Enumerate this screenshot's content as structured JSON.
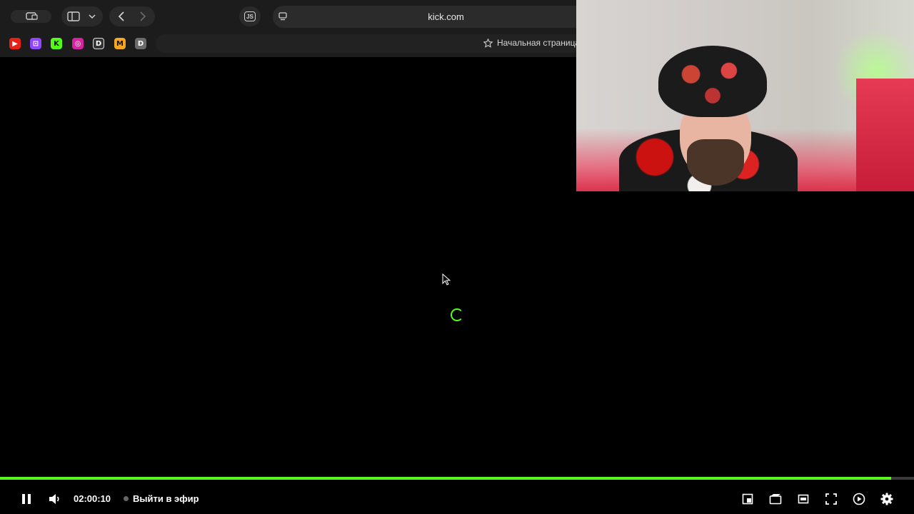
{
  "browser": {
    "url": "kick.com",
    "js_badge": "JS",
    "home_link": "Начальная страница",
    "bookmarks": [
      {
        "name": "youtube-bookmark",
        "glyph": "▶",
        "color": "#e62117"
      },
      {
        "name": "twitch-bookmark",
        "glyph": "⊡",
        "color": "#9146ff"
      },
      {
        "name": "kick-bookmark",
        "glyph": "K",
        "color": "#53fc18"
      },
      {
        "name": "instagram-bookmark",
        "glyph": "◎",
        "color": "#d6249f"
      },
      {
        "name": "di-bookmark",
        "glyph": "D",
        "color": "#333333"
      },
      {
        "name": "m-bookmark",
        "glyph": "M",
        "color": "#f5a623"
      },
      {
        "name": "d-bookmark",
        "glyph": "D",
        "color": "#6b6b6b"
      }
    ]
  },
  "player": {
    "time": "02:00:10",
    "live_label": "Выйти в эфир",
    "progress_fraction": 0.975,
    "accent": "#53fc18"
  }
}
